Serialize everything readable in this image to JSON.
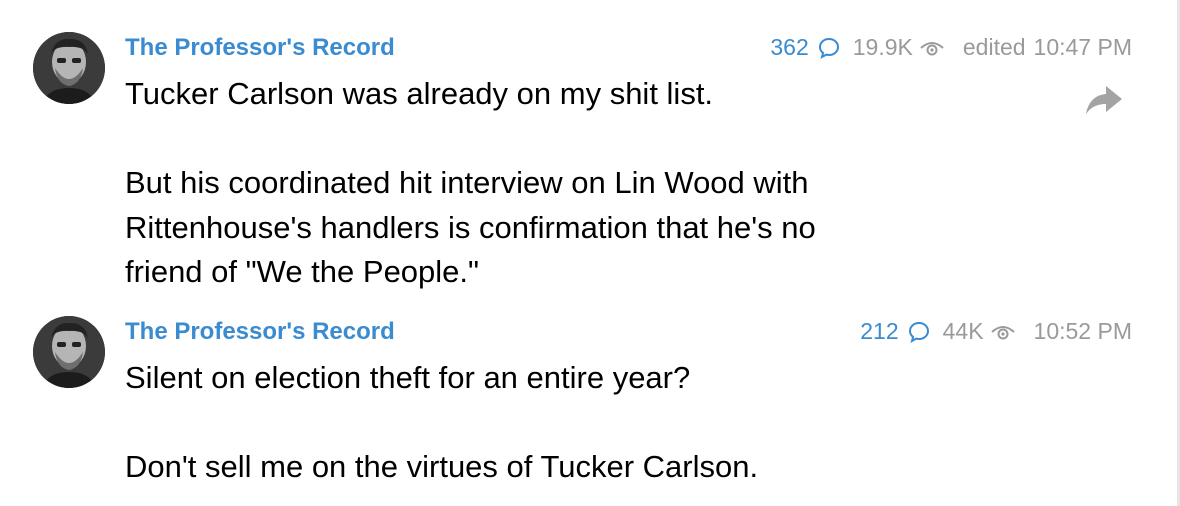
{
  "posts": [
    {
      "author": "The Professor's Record",
      "comments": "362",
      "views": "19.9K",
      "edited_label": "edited",
      "time": "10:47 PM",
      "lines": [
        "Tucker Carlson was already on my shit list.",
        "",
        "But his coordinated hit interview on Lin Wood with",
        "Rittenhouse's handlers is confirmation that he's no",
        "friend of \"We the People.\""
      ],
      "share_icon": "share-arrow-icon"
    },
    {
      "author": "The Professor's Record",
      "comments": "212",
      "views": "44K",
      "time": "10:52 PM",
      "lines": [
        "Silent on election theft for an entire year?",
        "",
        "Don't sell me on the virtues of Tucker Carlson."
      ]
    }
  ],
  "colors": {
    "author": "#3a8bd0",
    "comments": "#3a8bd0",
    "meta": "#9a9a9a",
    "text": "#000000",
    "share_icon": "#a3a3a3"
  },
  "icons": {
    "comment": "speech-bubble-icon",
    "views": "eye-icon",
    "share": "share-arrow-icon",
    "avatar": "avatar-photo"
  }
}
